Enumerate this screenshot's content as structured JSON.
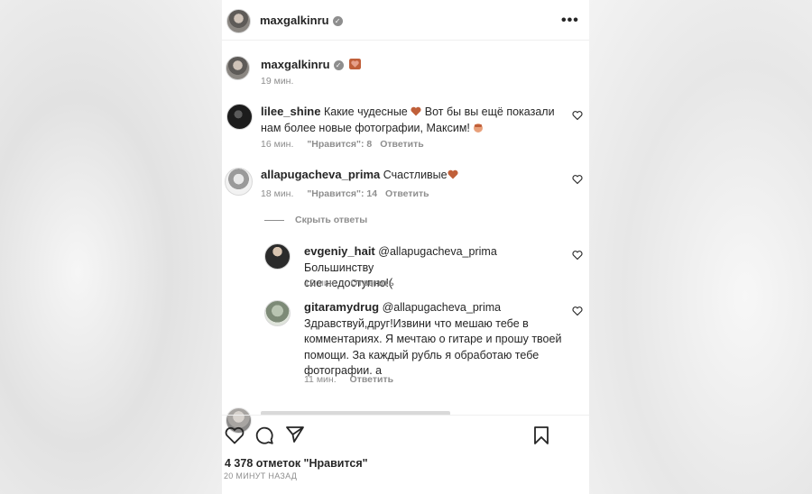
{
  "header": {
    "username": "maxgalkinru"
  },
  "caption": {
    "username": "maxgalkinru",
    "time": "19 мин."
  },
  "comments": [
    {
      "username": "lilee_shine",
      "text_line1": "Какие чудесные",
      "text_line1b": "Вот бы вы ещё показали",
      "text_line2": "нам более новые фотографии, Максим!",
      "time": "16 мин.",
      "likes": "\"Нравится\": 8",
      "reply": "Ответить"
    },
    {
      "username": "allapugacheva_prima",
      "text": "Счастливые",
      "time": "18 мин.",
      "likes": "\"Нравится\": 14",
      "reply": "Ответить"
    }
  ],
  "hide_replies": "Скрыть ответы",
  "replies": [
    {
      "username": "evgeniy_hait",
      "text_line1": "@allapugacheva_prima Большинству",
      "text_line2": "сие недоступно!(",
      "time": "12 мин.",
      "reply": "Ответить"
    },
    {
      "username": "gitaramydrug",
      "text_line1": "@allapugacheva_prima",
      "text_line2": "Здравствуй,друг!Извини что мешаю тебе в",
      "text_line3": "комментариях. Я мечтаю о гитаре и прошу твоей",
      "text_line4": "помощи. За каждый рубль я обработаю тебе",
      "text_line5": "фотографии. а",
      "time": "11 мин.",
      "reply": "Ответить"
    }
  ],
  "footer": {
    "likes_count": "4 378 отметок \"Нравится\"",
    "posted": "20 МИНУТ НАЗАД"
  },
  "icons": {
    "more": "more-icon",
    "heart": "heart-icon",
    "comment": "comment-icon",
    "share": "share-icon",
    "bookmark": "bookmark-icon"
  },
  "colors": {
    "emoji_heart": "#c0603a",
    "text": "#262626",
    "muted": "#8e8e8e"
  }
}
